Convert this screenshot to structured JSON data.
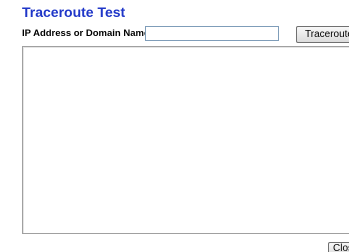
{
  "page": {
    "title": "Traceroute Test"
  },
  "form": {
    "field_label": "IP Address or Domain Name:",
    "ip_value": "",
    "ip_placeholder": "",
    "traceroute_button_label": "Traceroute",
    "output_text": ""
  },
  "footer": {
    "close_button_label": "Close"
  },
  "colors": {
    "title": "#1f36c8"
  }
}
